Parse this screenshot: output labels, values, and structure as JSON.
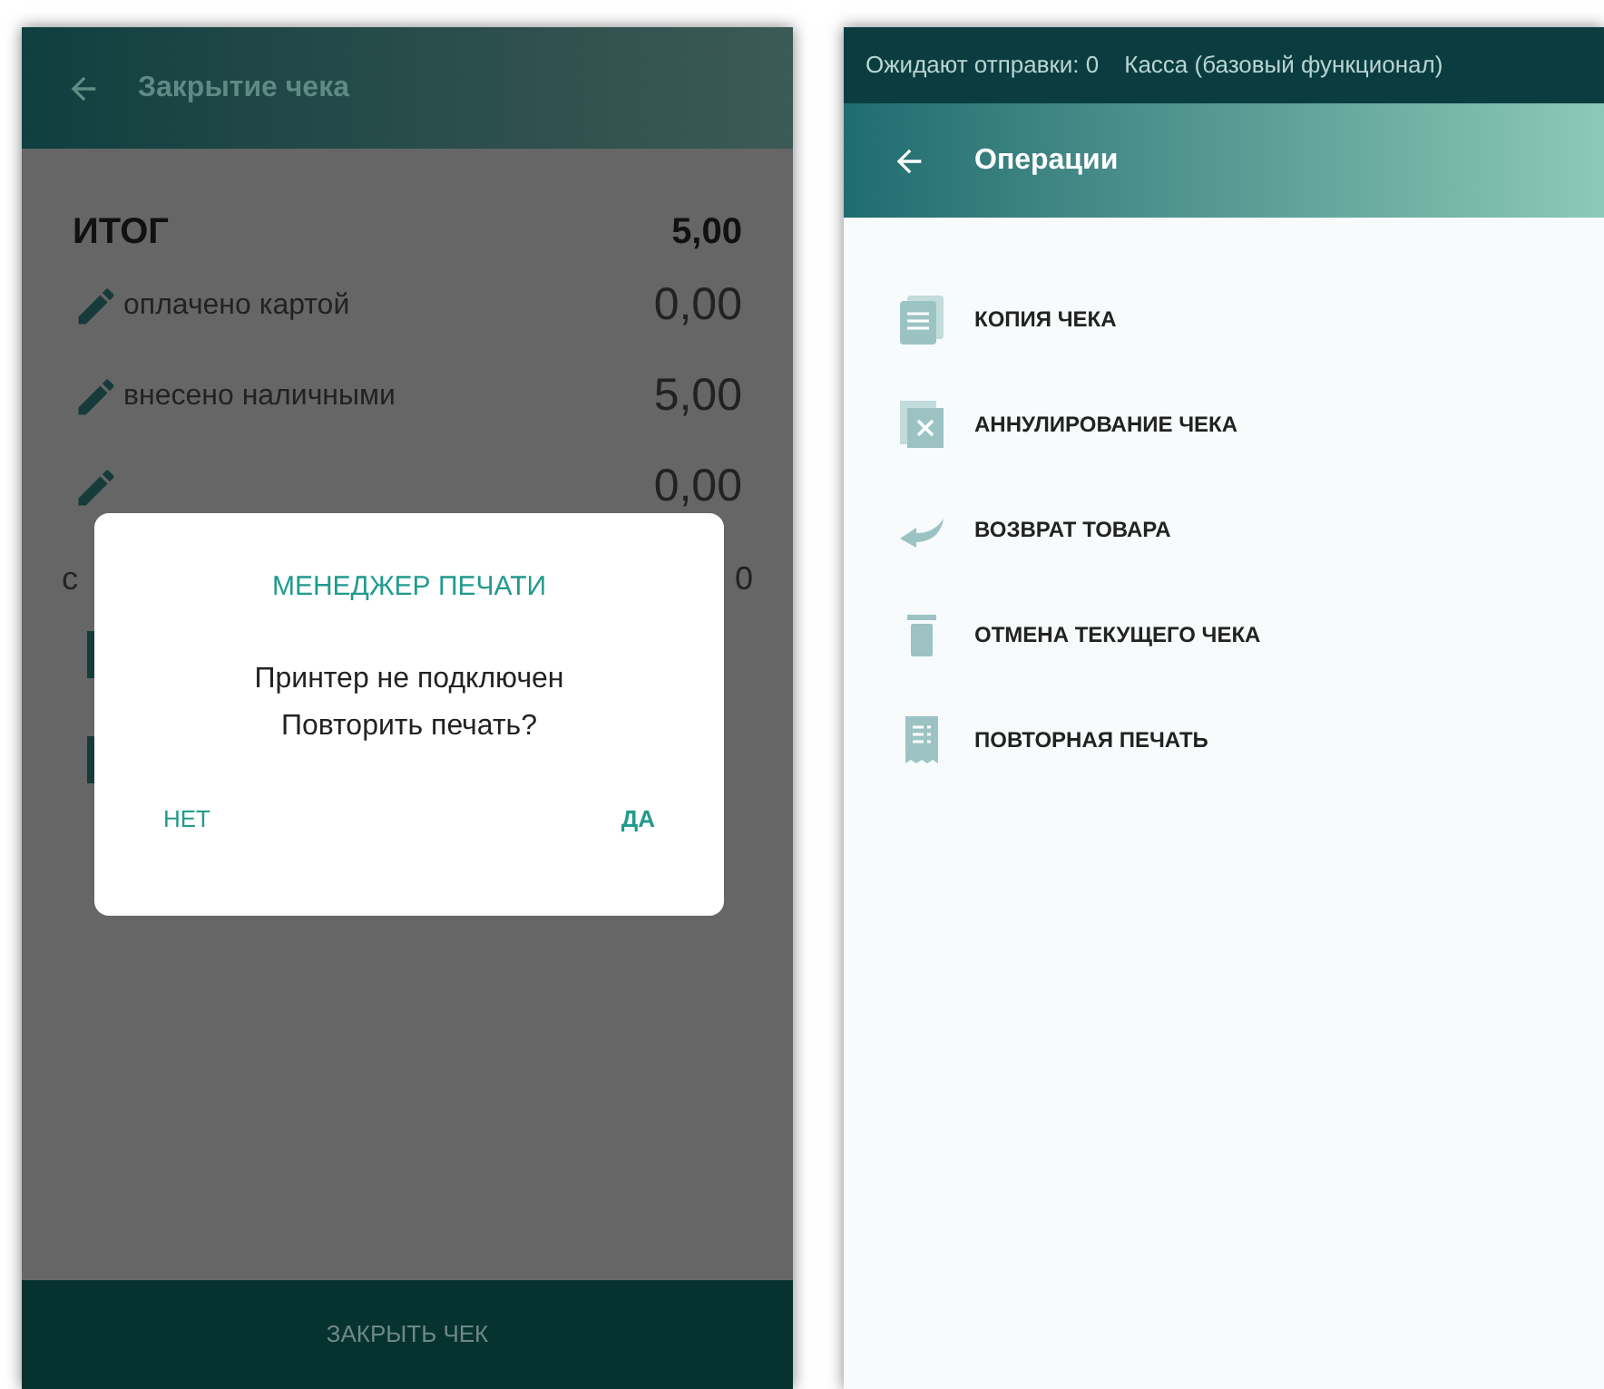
{
  "left_screen": {
    "title": "Закрытие чека",
    "total": {
      "label": "ИТОГ",
      "value": "5,00"
    },
    "payments": [
      {
        "label": "оплачено картой",
        "value": "0,00"
      },
      {
        "label": "внесено наличными",
        "value": "5,00"
      },
      {
        "value": "0,00"
      }
    ],
    "partial_row": {
      "label": "с",
      "value": "0"
    },
    "close_button": "ЗАКРЫТЬ ЧЕК",
    "dialog": {
      "title": "МЕНЕДЖЕР ПЕЧАТИ",
      "message": [
        "Принтер не подключен",
        "Повторить печать?"
      ],
      "buttons": [
        "НЕТ",
        "ДА"
      ]
    }
  },
  "right_screen": {
    "status_bar": [
      "Ожидают отправки: 0",
      "Касса (базовый функционал)"
    ],
    "title": "Операции",
    "items": [
      {
        "kind": "copy",
        "label": "КОПИЯ ЧЕКА"
      },
      {
        "kind": "cancel",
        "label": "АННУЛИРОВАНИЕ ЧЕКА"
      },
      {
        "kind": "return",
        "label": "ВОЗВРАТ ТОВАРА"
      },
      {
        "kind": "trash",
        "label": "ОТМЕНА ТЕКУЩЕГО ЧЕКА"
      },
      {
        "kind": "reprint",
        "label": "ПОВТОРНАЯ ПЕЧАТЬ"
      }
    ]
  }
}
